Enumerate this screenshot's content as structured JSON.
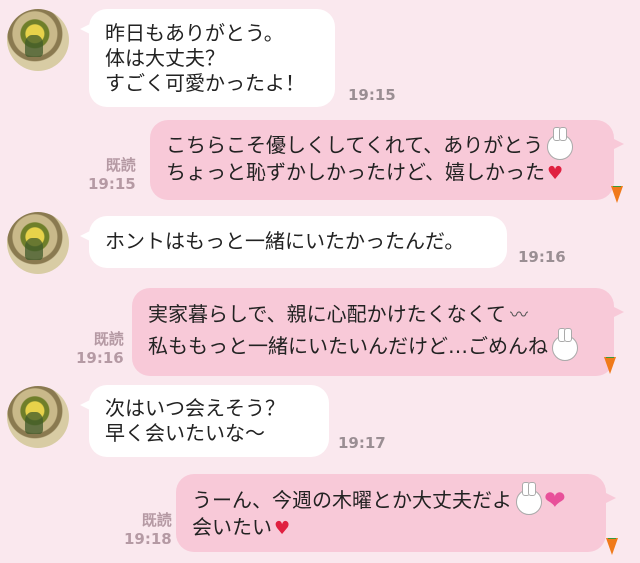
{
  "messages": [
    {
      "side": "left",
      "lines": [
        "昨日もありがとう。",
        "体は大丈夫？",
        "すごく可愛かったよ！"
      ],
      "time": "19:15"
    },
    {
      "side": "right",
      "lines": [
        "こちらこそ優しくしてくれて、ありがとう",
        "ちょっと恥ずかしかったけど、嬉しかった"
      ],
      "read": "既読",
      "time": "19:15"
    },
    {
      "side": "left",
      "lines": [
        "ホントはもっと一緒にいたかったんだ。"
      ],
      "time": "19:16"
    },
    {
      "side": "right",
      "lines": [
        "実家暮らしで、親に心配かけたくなくて",
        "私ももっと一緒にいたいんだけど…ごめんね"
      ],
      "read": "既読",
      "time": "19:16"
    },
    {
      "side": "left",
      "lines": [
        "次はいつ会えそう？",
        "早く会いたいな〜"
      ],
      "time": "19:17"
    },
    {
      "side": "right",
      "lines": [
        "うーん、今週の木曜とか大丈夫だよ",
        "会いたい"
      ],
      "read": "既読",
      "time": "19:18"
    }
  ],
  "icons": {
    "bunny": "bunny-sticker-icon",
    "heart": "heart-icon",
    "carrot": "carrot-icon"
  },
  "colors": {
    "background": "#fae8ee",
    "bubble_right": "#f8c9d8",
    "bubble_left": "#ffffff"
  }
}
